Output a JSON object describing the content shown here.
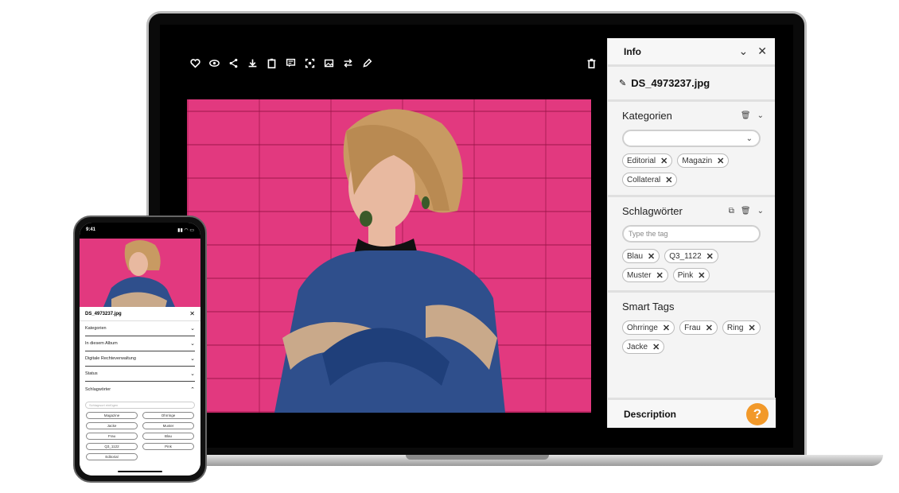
{
  "info_panel": {
    "title": "Info",
    "filename": "DS_4973237.jpg",
    "kategorien": {
      "title": "Kategorien",
      "selected": "",
      "chips": [
        "Editorial",
        "Magazin",
        "Collateral"
      ]
    },
    "schlagwoerter": {
      "title": "Schlagwörter",
      "placeholder": "Type the tag",
      "chips": [
        "Blau",
        "Q3_1122",
        "Muster",
        "Pink"
      ]
    },
    "smart_tags": {
      "title": "Smart Tags",
      "chips": [
        "Ohrringe",
        "Frau",
        "Ring",
        "Jacke"
      ]
    },
    "description": {
      "title": "Description"
    },
    "help_label": "?"
  },
  "toolbar": {
    "icons": [
      "heart-icon",
      "eye-icon",
      "share-icon",
      "download-icon",
      "clipboard-icon",
      "comment-icon",
      "crop-icon",
      "image-icon",
      "swap-icon",
      "pencil-icon"
    ],
    "trash": "trash-icon"
  },
  "phone": {
    "time": "9:41",
    "filename": "DS_4973237.jpg",
    "rows": [
      "Kategorien",
      "In diesem Album",
      "Digitale Rechteverwaltung",
      "Status",
      "Schlagwörter"
    ],
    "input_placeholder": "Schlagwort einfügen",
    "chips": [
      "Magazine",
      "Ohrringe",
      "Jacke",
      "Muster",
      "Frau",
      "Blau",
      "Q3_1122",
      "Pink",
      "Editorial"
    ]
  },
  "colors": {
    "accent": "#f2992a",
    "photo_bg": "#e2397f"
  }
}
